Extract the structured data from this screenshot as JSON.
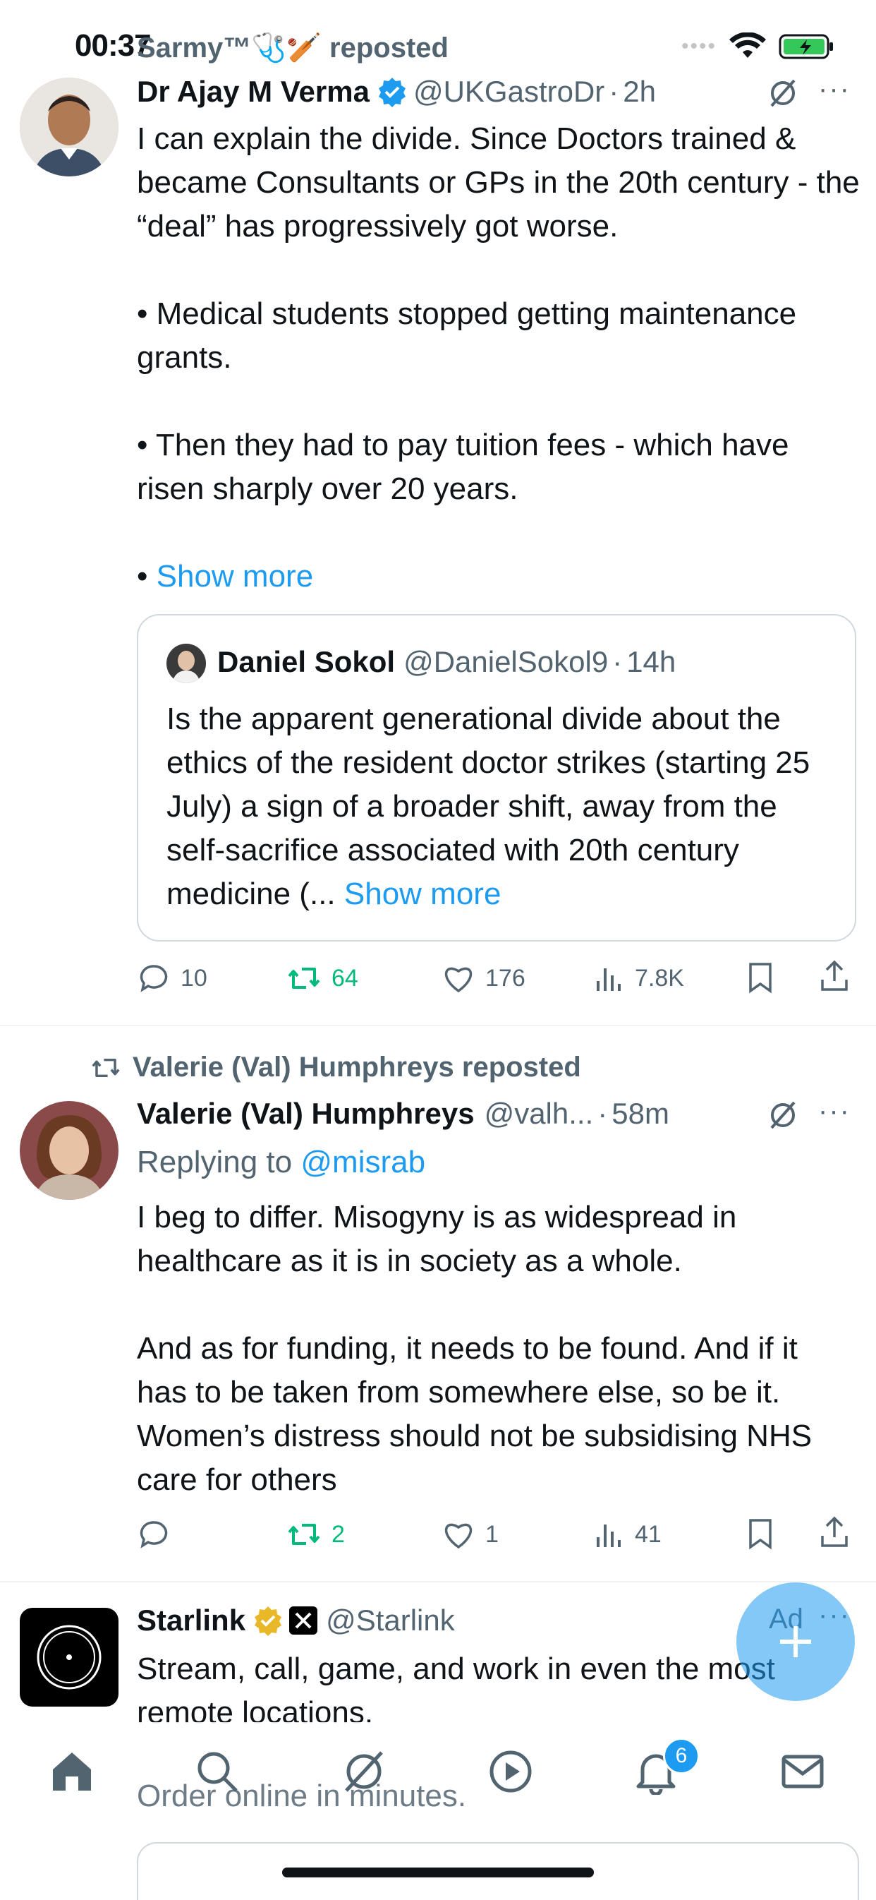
{
  "status_bar": {
    "time": "00:37"
  },
  "colors": {
    "accent": "#1d9bf0",
    "repost_green": "#00ba7c",
    "muted": "#536471",
    "verified_gold": "#e8b829"
  },
  "tweet1": {
    "repost_label": "Sarmy™🩺🏏 reposted",
    "author_name": "Dr Ajay M Verma",
    "author_handle": "@UKGastroDr",
    "sep": "·",
    "time": "2h",
    "body": "I can explain the divide. Since Doctors trained & became Consultants or GPs in the 20th century - the “deal” has progressively got worse.\n\n• Medical students stopped getting maintenance grants.\n\n• Then they had to pay tuition fees - which have risen sharply over 20 years.\n\n• ",
    "show_more": "Show more",
    "quote": {
      "author_name": "Daniel Sokol",
      "author_handle": "@DanielSokol9",
      "time": "14h",
      "body": "Is the apparent generational divide about the ethics of the resident doctor strikes (starting 25 July) a sign of a broader shift, away from the self-sacrifice associated with 20th century medicine (...",
      "show_more": "Show more"
    },
    "stats": {
      "replies": "10",
      "reposts": "64",
      "likes": "176",
      "views": "7.8K"
    }
  },
  "tweet2": {
    "repost_label": "Valerie (Val) Humphreys reposted",
    "author_name": "Valerie (Val) Humphreys",
    "author_handle": "@valh...",
    "sep": "·",
    "time": "58m",
    "replying_prefix": "Replying to",
    "replying_to": "@misrab",
    "body": "I beg to differ. Misogyny is as widespread in healthcare as it is in society as a whole.\n\nAnd as for funding, it needs to be found. And if it has to be taken from somewhere else, so be it. Women’s distress should not be subsidising NHS care for others",
    "stats": {
      "replies": "",
      "reposts": "2",
      "likes": "1",
      "views": "41"
    }
  },
  "ad": {
    "author_name": "Starlink",
    "author_handle": "@Starlink",
    "ad_label": "Ad",
    "body": "Stream, call, game, and work in even the most remote locations.",
    "body2": "Order online in minutes."
  },
  "tabbar": {
    "notifications_badge": "6",
    "icons": [
      "home-icon",
      "search-icon",
      "grok-icon",
      "video-icon",
      "bell-icon",
      "mail-icon"
    ]
  }
}
